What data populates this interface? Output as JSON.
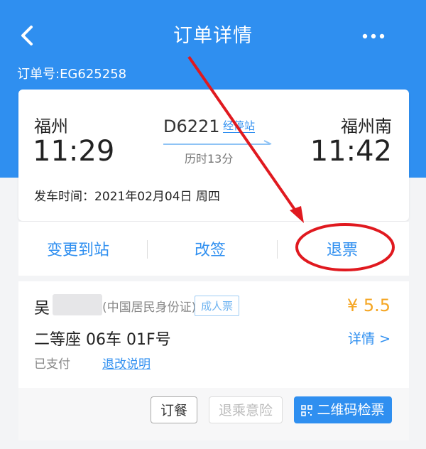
{
  "header": {
    "title": "订单详情",
    "order_label": "订单号:EG625258"
  },
  "trip": {
    "from_station": "福州",
    "from_time": "11:29",
    "to_station": "福州南",
    "to_time": "11:42",
    "train_no": "D6221",
    "stops_label": "经停站",
    "duration": "历时13分",
    "depart_label": "发车时间：",
    "depart_value": "2021年02月04日 周四"
  },
  "actions": {
    "change_station": "变更到站",
    "reschedule": "改签",
    "refund": "退票"
  },
  "passenger": {
    "name": "吴",
    "id_type": "(中国居民身份证)",
    "ticket_type": "成人票",
    "price": "¥ 5.5",
    "seat": "二等座 06车 01F号",
    "detail": "详情 >",
    "status": "已支付",
    "policy": "退改说明"
  },
  "footer": {
    "meal": "订餐",
    "insurance": "退乘意险",
    "qr": "二维码检票"
  },
  "colors": {
    "brand": "#2f8ff0",
    "price": "#f5a623",
    "annotation": "#e0191f"
  },
  "icons": [
    "back-icon",
    "more-icon",
    "qr-icon"
  ]
}
